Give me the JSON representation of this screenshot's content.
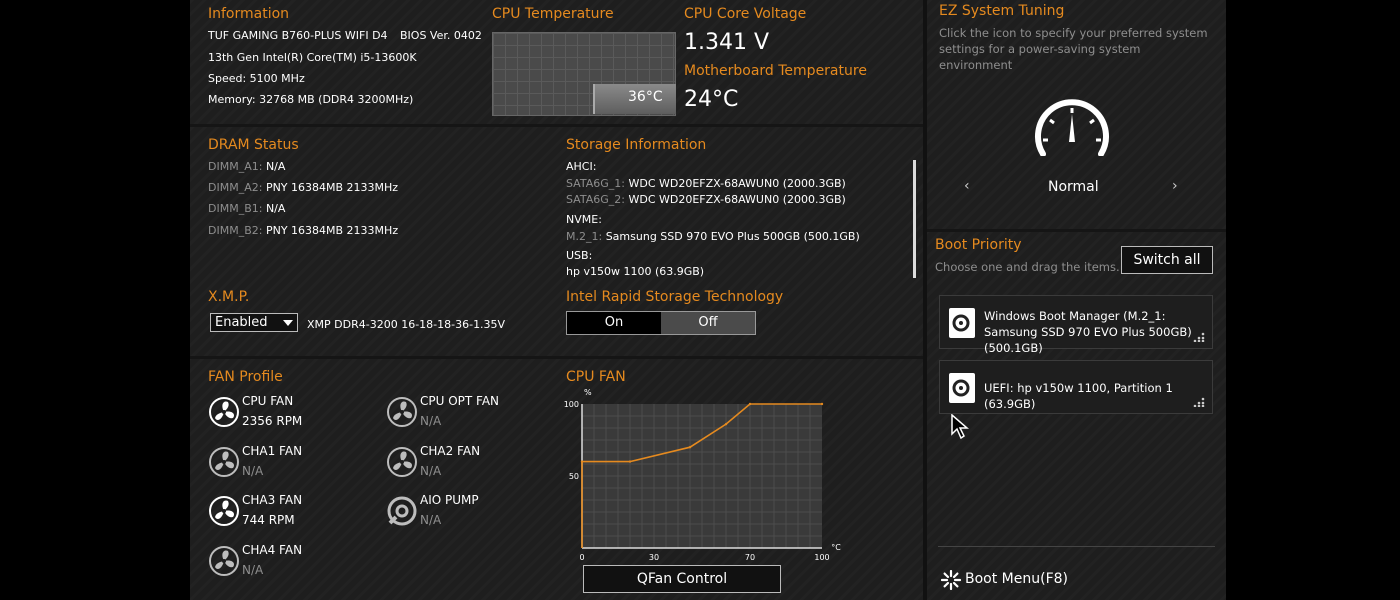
{
  "information": {
    "title": "Information",
    "board": "TUF GAMING B760-PLUS WIFI D4",
    "bios": "BIOS Ver. 0402",
    "cpu": "13th Gen Intel(R) Core(TM) i5-13600K",
    "speed": "Speed: 5100 MHz",
    "memory": "Memory: 32768 MB (DDR4 3200MHz)"
  },
  "cpu_temp": {
    "title": "CPU Temperature",
    "value": "36°C",
    "level_fraction": 0.36
  },
  "cpu_voltage": {
    "title": "CPU Core Voltage",
    "value": "1.341 V"
  },
  "mb_temp": {
    "title": "Motherboard Temperature",
    "value": "24°C"
  },
  "dram": {
    "title": "DRAM Status",
    "slots": [
      {
        "name": "DIMM_A1:",
        "value": "N/A"
      },
      {
        "name": "DIMM_A2:",
        "value": "PNY 16384MB 2133MHz"
      },
      {
        "name": "DIMM_B1:",
        "value": "N/A"
      },
      {
        "name": "DIMM_B2:",
        "value": "PNY 16384MB 2133MHz"
      }
    ]
  },
  "storage": {
    "title": "Storage Information",
    "ahci_label": "AHCI:",
    "ahci": [
      {
        "port": "SATA6G_1:",
        "device": "WDC WD20EFZX-68AWUN0 (2000.3GB)"
      },
      {
        "port": "SATA6G_2:",
        "device": "WDC WD20EFZX-68AWUN0 (2000.3GB)"
      }
    ],
    "nvme_label": "NVME:",
    "nvme": [
      {
        "port": "M.2_1:",
        "device": "Samsung SSD 970 EVO Plus 500GB (500.1GB)"
      }
    ],
    "usb_label": "USB:",
    "usb": "hp v150w 1100 (63.9GB)"
  },
  "xmp": {
    "title": "X.M.P.",
    "selected": "Enabled",
    "profile": "XMP DDR4-3200 16-18-18-36-1.35V"
  },
  "rst": {
    "title": "Intel Rapid Storage Technology",
    "on_label": "On",
    "off_label": "Off",
    "selected": "Off"
  },
  "fan_profile": {
    "title": "FAN Profile",
    "fans": [
      {
        "name": "CPU FAN",
        "value": "2356 RPM",
        "active": true
      },
      {
        "name": "CPU OPT FAN",
        "value": "N/A",
        "active": false
      },
      {
        "name": "CHA1 FAN",
        "value": "N/A",
        "active": false
      },
      {
        "name": "CHA2 FAN",
        "value": "N/A",
        "active": false
      },
      {
        "name": "CHA3 FAN",
        "value": "744 RPM",
        "active": true
      },
      {
        "name": "AIO PUMP",
        "value": "N/A",
        "active": false
      },
      {
        "name": "CHA4 FAN",
        "value": "N/A",
        "active": false
      }
    ]
  },
  "cpu_fan": {
    "title": "CPU FAN",
    "qfan_label": "QFan Control",
    "chart_data": {
      "type": "line",
      "ylabel": "%",
      "xlabel": "°C",
      "xlim": [
        0,
        100
      ],
      "ylim": [
        0,
        100
      ],
      "x_ticks": [
        "0",
        "30",
        "70",
        "100"
      ],
      "y_ticks": [
        "100",
        "50"
      ],
      "series": [
        {
          "x": [
            0,
            20,
            45,
            60,
            70,
            100
          ],
          "y": [
            60,
            60,
            70,
            86,
            100,
            100
          ]
        }
      ],
      "line_color": "#e58a1f"
    }
  },
  "ez_tuning": {
    "title": "EZ System Tuning",
    "description": "Click the icon to specify your preferred system settings for a power-saving system environment",
    "mode": "Normal"
  },
  "boot_priority": {
    "title": "Boot Priority",
    "subtitle": "Choose one and drag the items.",
    "switch_label": "Switch all",
    "items": [
      {
        "label": "Windows Boot Manager (M.2_1: Samsung SSD 970 EVO Plus 500GB) (500.1GB)"
      },
      {
        "label": "UEFI: hp v150w 1100, Partition 1 (63.9GB)"
      }
    ]
  },
  "boot_menu": {
    "label": "Boot Menu(F8)"
  }
}
